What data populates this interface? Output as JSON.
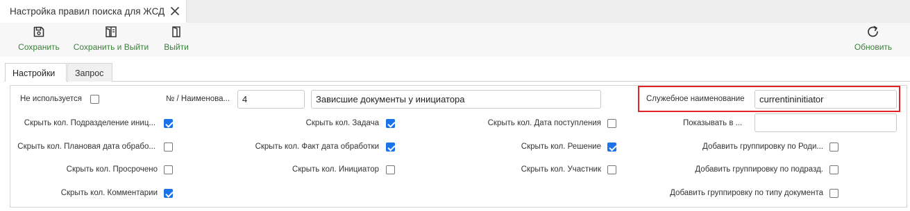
{
  "doc_tab": {
    "title": "Настройка правил поиска для ЖСД"
  },
  "toolbar": {
    "save": "Сохранить",
    "save_exit": "Сохранить и Выйти",
    "exit": "Выйти",
    "refresh": "Обновить"
  },
  "tabs": {
    "settings": "Настройки",
    "query": "Запрос"
  },
  "form": {
    "not_used": {
      "label": "Не используется",
      "checked": false
    },
    "number_name_label": "№ / Наименова...",
    "number_value": "4",
    "name_value": "Зависшие документы у инициатора",
    "service_name_label": "Служебное наименование",
    "service_name_value": "currentininitiator",
    "show_in_label": "Показывать в ...",
    "show_in_value": "",
    "col1": [
      {
        "label": "Скрыть кол. Подразделение иниц...",
        "checked": true
      },
      {
        "label": "Скрыть кол. Плановая дата обрабо...",
        "checked": false
      },
      {
        "label": "Скрыть кол. Просрочено",
        "checked": false
      },
      {
        "label": "Скрыть кол. Комментарии",
        "checked": true
      }
    ],
    "col2": [
      {
        "label": "Скрыть кол. Задача",
        "checked": true
      },
      {
        "label": "Скрыть кол. Факт дата обработки",
        "checked": true
      },
      {
        "label": "Скрыть кол. Инициатор",
        "checked": false
      }
    ],
    "col3": [
      {
        "label": "Скрыть кол. Дата поступления",
        "checked": false
      },
      {
        "label": "Скрыть кол. Решение",
        "checked": true
      },
      {
        "label": "Скрыть кол. Участник",
        "checked": false
      }
    ],
    "col4": [
      {
        "label": "Добавить группировку по Роди...",
        "checked": false
      },
      {
        "label": "Добавить группировку по подразд.",
        "checked": false
      },
      {
        "label": "Добавить группировку по типу документа",
        "checked": false
      }
    ]
  },
  "colors": {
    "accent": "#1a73e8",
    "toolbar_text": "#3c7d3a",
    "highlight": "#e02424"
  }
}
